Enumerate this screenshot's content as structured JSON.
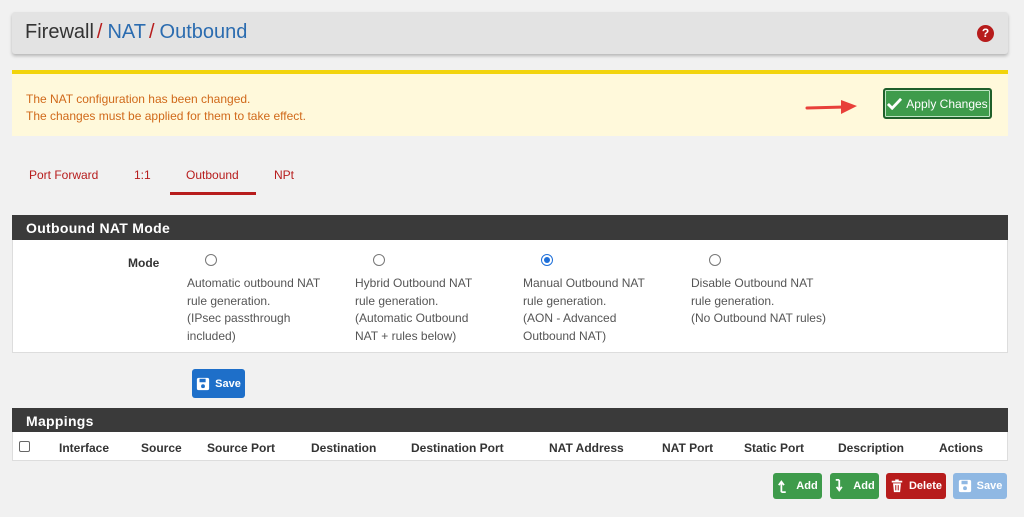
{
  "breadcrumb": {
    "root": "Firewall",
    "level2": "NAT",
    "level3": "Outbound",
    "separator": "/"
  },
  "help_icon": "question-circle-icon",
  "alert": {
    "line1": "The NAT configuration has been changed.",
    "line2": "The changes must be applied for them to take effect.",
    "apply_label": "Apply Changes"
  },
  "tabs": [
    {
      "label": "Port Forward",
      "active": false
    },
    {
      "label": "1:1",
      "active": false
    },
    {
      "label": "Outbound",
      "active": true
    },
    {
      "label": "NPt",
      "active": false
    }
  ],
  "mode_panel": {
    "title": "Outbound NAT Mode",
    "field_label": "Mode",
    "options": [
      {
        "l1": "Automatic outbound NAT",
        "l2": "rule generation.",
        "l3": "(IPsec passthrough",
        "l4": "included)",
        "selected": false
      },
      {
        "l1": "Hybrid Outbound NAT",
        "l2": "rule generation.",
        "l3": "(Automatic Outbound",
        "l4": "NAT + rules below)",
        "selected": false
      },
      {
        "l1": "Manual Outbound NAT",
        "l2": "rule generation.",
        "l3": "(AON - Advanced",
        "l4": "Outbound NAT)",
        "selected": true
      },
      {
        "l1": "Disable Outbound NAT",
        "l2": "rule generation.",
        "l3": "(No Outbound NAT rules)",
        "l4": "",
        "selected": false
      }
    ],
    "save_label": "Save"
  },
  "mappings": {
    "title": "Mappings",
    "columns": [
      "Interface",
      "Source",
      "Source Port",
      "Destination",
      "Destination Port",
      "NAT Address",
      "NAT Port",
      "Static Port",
      "Description",
      "Actions"
    ]
  },
  "actions": {
    "add_top_label": "Add",
    "add_bottom_label": "Add",
    "delete_label": "Delete",
    "save_label": "Save"
  }
}
